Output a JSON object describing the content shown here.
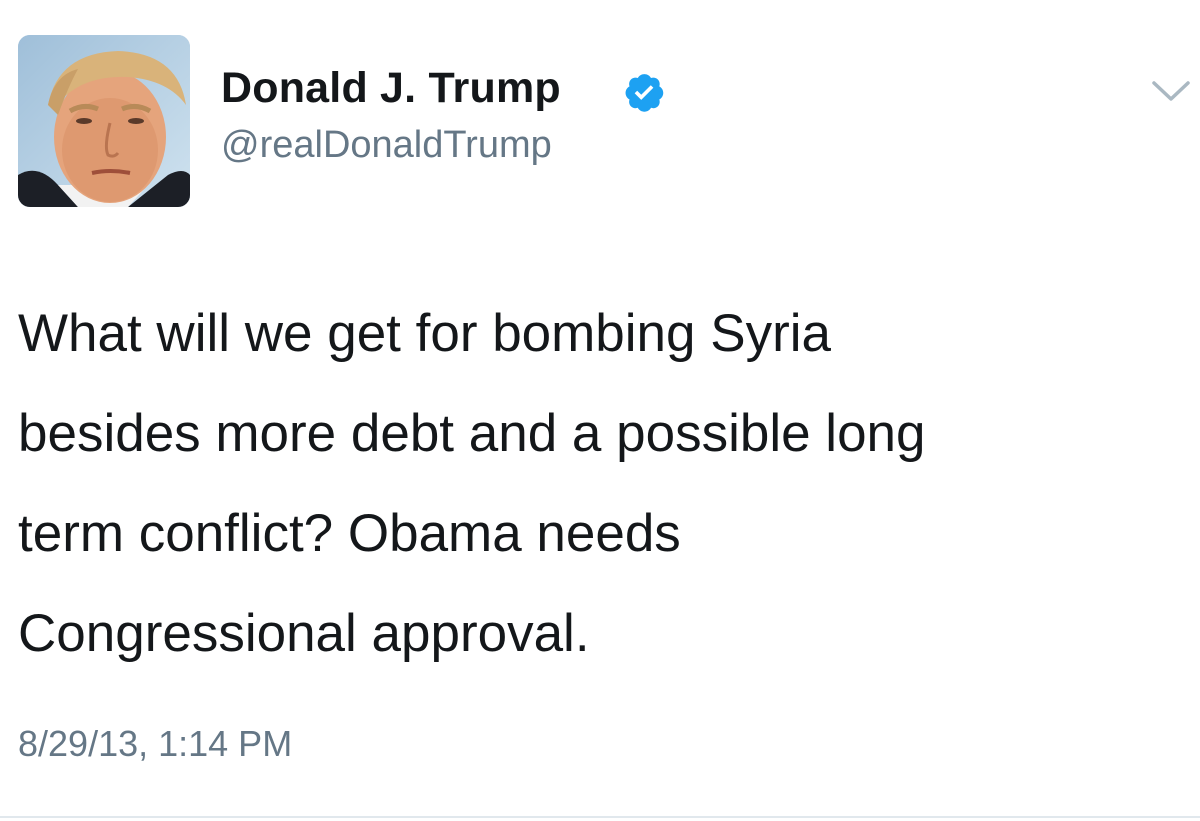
{
  "user": {
    "display_name": "Donald J. Trump",
    "handle": "@realDonaldTrump",
    "verified": true,
    "avatar_icon": "profile-photo"
  },
  "tweet": {
    "lines": [
      "What will we get for bombing Syria",
      "besides more debt and a possible long",
      "term conflict? Obama needs",
      "Congressional approval."
    ],
    "timestamp": "8/29/13, 1:14 PM"
  },
  "icons": {
    "verified": "verified-badge-icon",
    "menu": "chevron-down-icon"
  },
  "colors": {
    "text": "#14171a",
    "secondary_text": "#657786",
    "verified_blue": "#1da1f2",
    "chevron": "#aab8c2",
    "divider": "#e1e8ed"
  }
}
